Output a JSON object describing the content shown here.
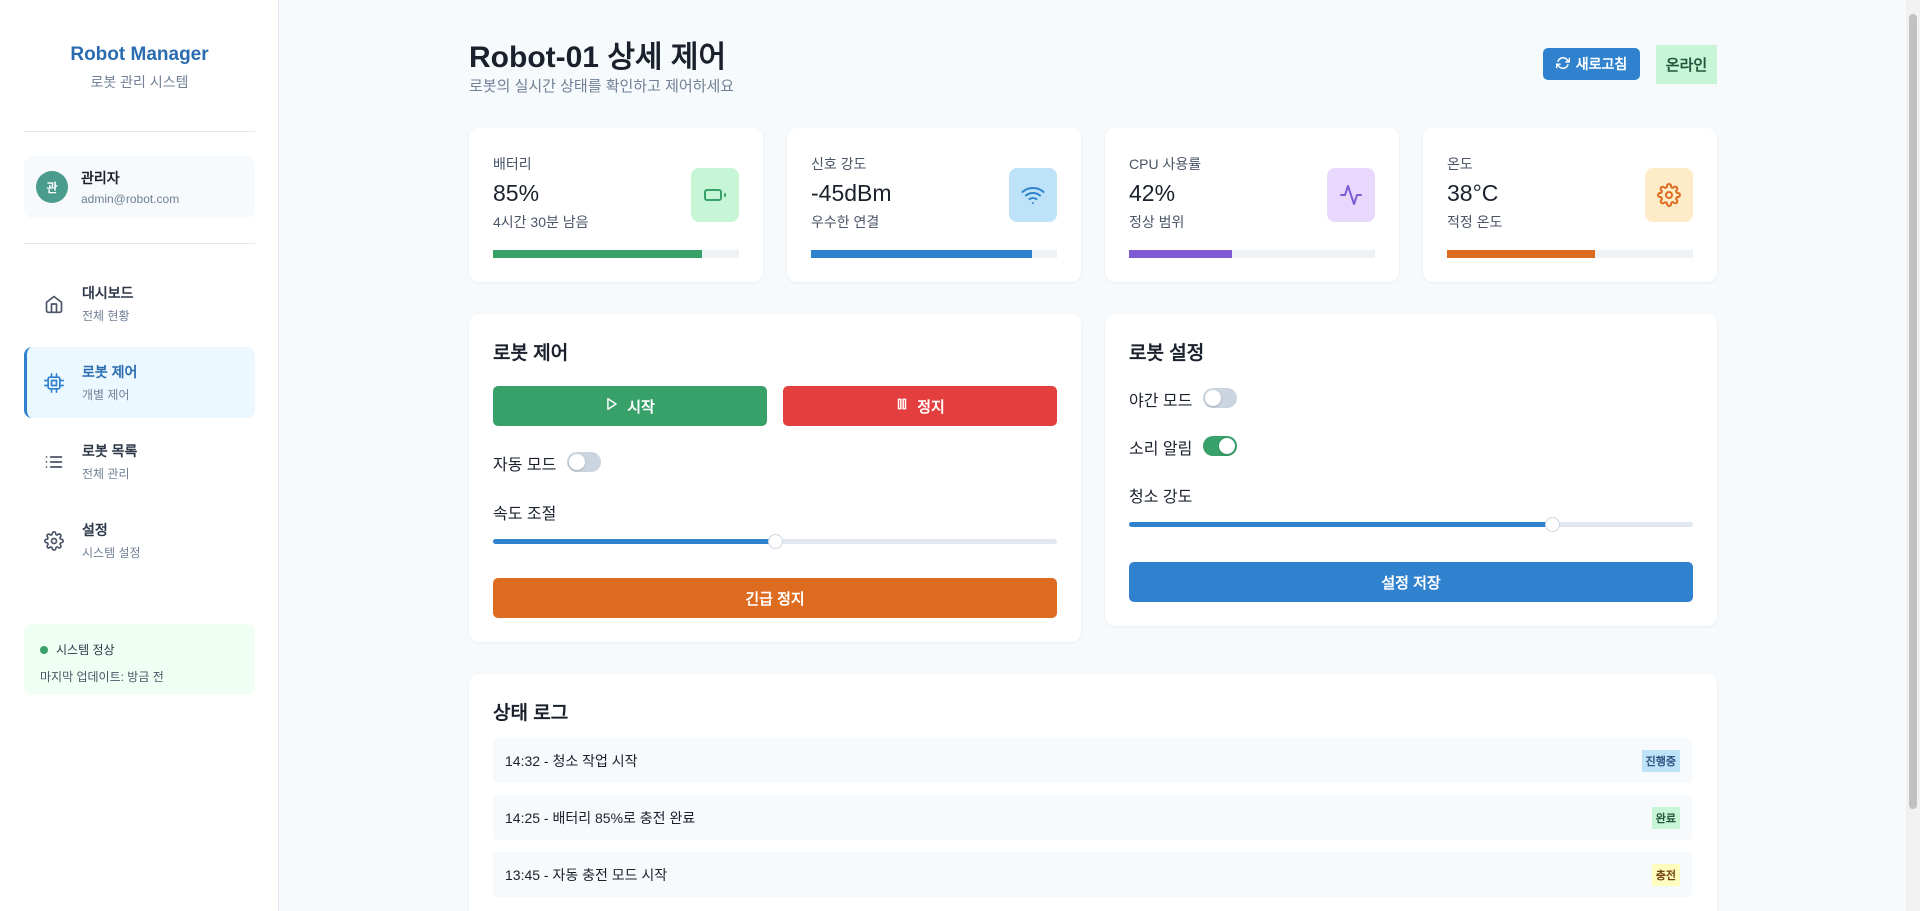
{
  "sidebar": {
    "brand_title": "Robot Manager",
    "brand_subtitle": "로봇 관리 시스템",
    "user": {
      "avatar_initial": "관",
      "name": "관리자",
      "email": "admin@robot.com"
    },
    "nav": [
      {
        "label": "대시보드",
        "sub": "전체 현황",
        "icon": "home-icon"
      },
      {
        "label": "로봇 제어",
        "sub": "개별 제어",
        "icon": "cpu-icon",
        "active": true
      },
      {
        "label": "로봇 목록",
        "sub": "전체 관리",
        "icon": "list-icon"
      },
      {
        "label": "설정",
        "sub": "시스템 설정",
        "icon": "gear-icon"
      }
    ],
    "status": {
      "text": "시스템 정상",
      "update": "마지막 업데이트: 방금 전"
    }
  },
  "header": {
    "title": "Robot-01 상세 제어",
    "subtitle": "로봇의 실시간 상태를 확인하고 제어하세요",
    "refresh_label": "새로고침",
    "online_label": "온라인"
  },
  "stats": [
    {
      "label": "배터리",
      "value": "85%",
      "sub": "4시간 30분 남음",
      "progress": 0.85,
      "color": "#38a169",
      "icon_bg": "#c6f6d5",
      "icon_color": "#38a169",
      "icon": "battery-icon"
    },
    {
      "label": "신호 강도",
      "value": "-45dBm",
      "sub": "우수한 연결",
      "progress": 0.9,
      "color": "#3182ce",
      "icon_bg": "#bee3f8",
      "icon_color": "#3182ce",
      "icon": "wifi-icon"
    },
    {
      "label": "CPU 사용률",
      "value": "42%",
      "sub": "정상 범위",
      "progress": 0.42,
      "color": "#805ad5",
      "icon_bg": "#e9d8fd",
      "icon_color": "#805ad5",
      "icon": "activity-icon"
    },
    {
      "label": "온도",
      "value": "38°C",
      "sub": "적정 온도",
      "progress": 0.6,
      "color": "#dd6b20",
      "icon_bg": "#feebc8",
      "icon_color": "#dd6b20",
      "icon": "gear-icon"
    }
  ],
  "control": {
    "title": "로봇 제어",
    "start_label": "시작",
    "stop_label": "정지",
    "auto_mode_label": "자동 모드",
    "auto_mode_on": false,
    "speed_label": "속도 조절",
    "speed_value": 0.5,
    "emergency_label": "긴급 정지"
  },
  "settings": {
    "title": "로봇 설정",
    "night_mode_label": "야간 모드",
    "night_mode_on": false,
    "sound_label": "소리 알림",
    "sound_on": true,
    "clean_strength_label": "청소 강도",
    "clean_strength_value": 0.75,
    "save_label": "설정 저장"
  },
  "log": {
    "title": "상태 로그",
    "items": [
      {
        "text": "14:32 - 청소 작업 시작",
        "badge": "진행중",
        "badge_bg": "#bee3f8",
        "badge_color": "#2c5282"
      },
      {
        "text": "14:25 - 배터리 85%로 충전 완료",
        "badge": "완료",
        "badge_bg": "#c6f6d5",
        "badge_color": "#22543d"
      },
      {
        "text": "13:45 - 자동 충전 모드 시작",
        "badge": "충전",
        "badge_bg": "#fefcbf",
        "badge_color": "#744210"
      }
    ]
  },
  "colors": {
    "primary": "#3182ce",
    "success": "#38a169",
    "danger": "#e53e3e",
    "warning": "#dd6b20"
  }
}
